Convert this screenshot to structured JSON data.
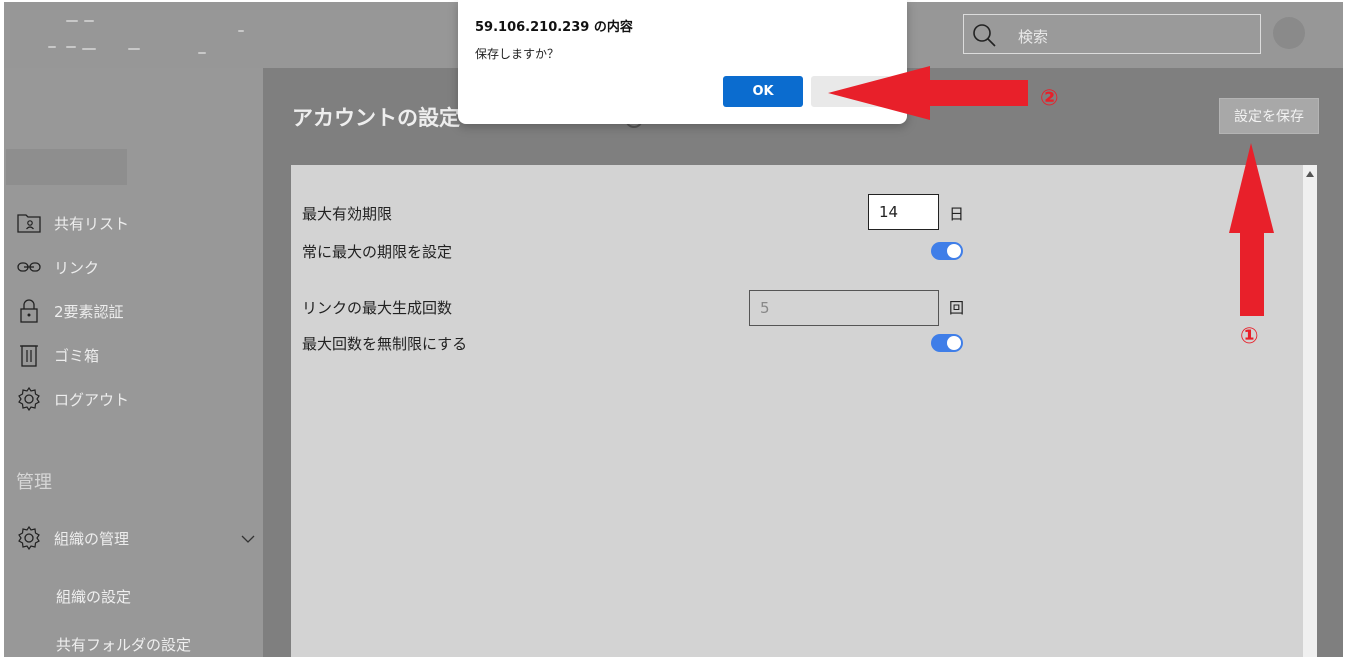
{
  "header": {
    "search_placeholder": "検索"
  },
  "sidebar": {
    "items": [
      {
        "label": "共有リスト",
        "icon": "shared-list-icon"
      },
      {
        "label": "リンク",
        "icon": "link-icon"
      },
      {
        "label": "2要素認証",
        "icon": "lock-icon"
      },
      {
        "label": "ゴミ箱",
        "icon": "trash-icon"
      },
      {
        "label": "ログアウト",
        "icon": "gear-icon"
      }
    ],
    "section_heading": "管理",
    "org_item": {
      "label": "組織の管理",
      "icon": "gear-icon"
    },
    "sub_items": [
      "組織の設定",
      "共有フォルダの設定"
    ]
  },
  "main": {
    "page_title": "アカウントの設定",
    "save_button": "設定を保存",
    "settings": {
      "max_validity_label": "最大有効期限",
      "max_validity_value": "14",
      "max_validity_unit": "日",
      "always_max_label": "常に最大の期限を設定",
      "always_max_on": true,
      "max_links_label": "リンクの最大生成回数",
      "max_links_value": "5",
      "max_links_unit": "回",
      "unlimited_label": "最大回数を無制限にする",
      "unlimited_on": true
    }
  },
  "dialog": {
    "title": "59.106.210.239 の内容",
    "message": "保存しますか？",
    "ok_label": "OK",
    "cancel_label": ""
  },
  "annotations": {
    "step1": "①",
    "step2": "②",
    "arrow_color": "#e8202a"
  },
  "colors": {
    "toggle_on": "#3f7ee8",
    "ok_button": "#0b6ccf"
  }
}
